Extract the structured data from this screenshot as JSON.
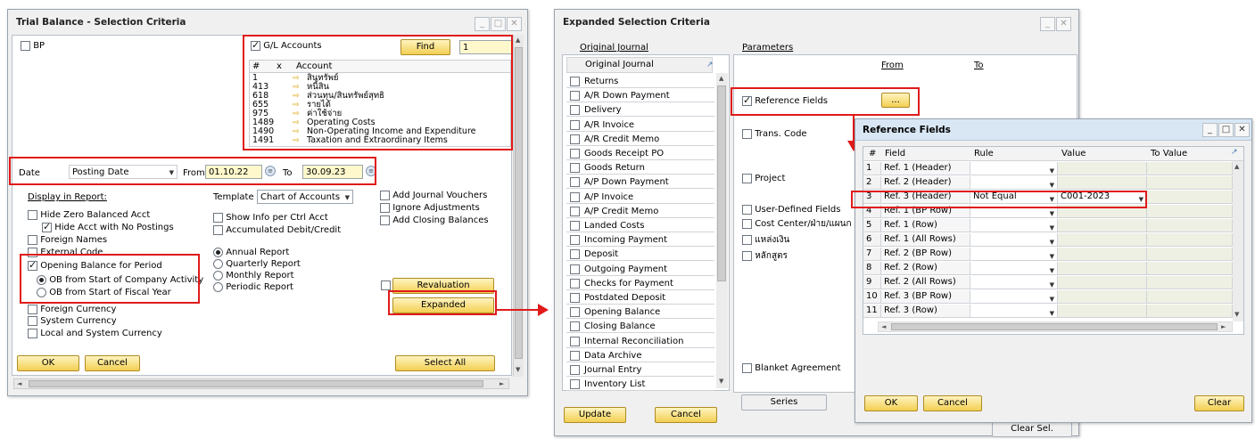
{
  "colors": {
    "accent": "#e01a1a",
    "button": "#f2cf52",
    "title_blue": "#d9e7f5"
  },
  "trial_balance": {
    "title": "Trial Balance - Selection Criteria",
    "bp_label": "BP",
    "gl_accounts_label": "G/L Accounts",
    "find_label": "Find",
    "find_value": "1",
    "accounts_headers": [
      "#",
      "x",
      "Account"
    ],
    "accounts": [
      {
        "num": "1",
        "name": "สินทรัพย์"
      },
      {
        "num": "413",
        "name": "หนี้สิน"
      },
      {
        "num": "618",
        "name": "ส่วนทุน/สินทรัพย์สุทธิ"
      },
      {
        "num": "655",
        "name": "รายได้"
      },
      {
        "num": "975",
        "name": "ค่าใช้จ่าย"
      },
      {
        "num": "1489",
        "name": "Operating Costs"
      },
      {
        "num": "1490",
        "name": "Non-Operating Income and Expenditure"
      },
      {
        "num": "1491",
        "name": "Taxation and Extraordinary Items"
      }
    ],
    "date_label": "Date",
    "date_type": "Posting Date",
    "from_label": "From",
    "from_date": "01.10.22",
    "to_label": "To",
    "to_date": "30.09.23",
    "display_in_report": "Display in Report:",
    "template_label": "Template",
    "template_value": "Chart of Accounts",
    "hide_zero": "Hide Zero Balanced Acct",
    "hide_no_postings": "Hide Acct with No Postings",
    "foreign_names": "Foreign Names",
    "external_code": "External Code",
    "opening_balance": "Opening Balance for Period",
    "ob_company": "OB from Start of Company Activity",
    "ob_fiscal": "OB from Start of Fiscal Year",
    "foreign_currency": "Foreign Currency",
    "system_currency": "System Currency",
    "local_system_currency": "Local and System Currency",
    "show_info": "Show Info per Ctrl Acct",
    "accumulated": "Accumulated Debit/Credit",
    "annual": "Annual Report",
    "quarterly": "Quarterly Report",
    "monthly": "Monthly Report",
    "periodic": "Periodic Report",
    "add_journal": "Add Journal Vouchers",
    "ignore_adj": "Ignore Adjustments",
    "add_closing": "Add Closing Balances",
    "revaluation": "Revaluation",
    "expanded": "Expanded",
    "ok": "OK",
    "cancel": "Cancel",
    "select_all": "Select All"
  },
  "expanded": {
    "title": "Expanded Selection Criteria",
    "original_journal_tab": "Original Journal",
    "parameters_tab": "Parameters",
    "list_header": "Original Journal",
    "journals": [
      "Returns",
      "A/R Down Payment",
      "Delivery",
      "A/R Invoice",
      "A/R Credit Memo",
      "Goods Receipt PO",
      "Goods Return",
      "A/P Down Payment",
      "A/P Invoice",
      "A/P Credit Memo",
      "Landed Costs",
      "Incoming Payment",
      "Deposit",
      "Outgoing Payment",
      "Checks for Payment",
      "Postdated Deposit",
      "Opening Balance",
      "Closing Balance",
      "Internal Reconciliation",
      "Data Archive",
      "Journal Entry",
      "Inventory List"
    ],
    "from_label": "From",
    "to_label": "To",
    "reference_fields": "Reference Fields",
    "ellipsis": "...",
    "trans_code": "Trans. Code",
    "project": "Project",
    "udf": "User-Defined Fields",
    "cost_center": "Cost Center/ฝ่าย/แผนก",
    "source_money": "แหล่งเงิน",
    "course": "หลักสูตร",
    "blanket": "Blanket Agreement",
    "series": "Series",
    "clear_sel": "Clear Sel.",
    "update": "Update",
    "cancel": "Cancel"
  },
  "reference_fields": {
    "title": "Reference Fields",
    "headers": [
      "#",
      "Field",
      "Rule",
      "Value",
      "To Value"
    ],
    "rows": [
      {
        "n": "1",
        "field": "Ref. 1 (Header)",
        "rule": "",
        "value": ""
      },
      {
        "n": "2",
        "field": "Ref. 2 (Header)",
        "rule": "",
        "value": ""
      },
      {
        "n": "3",
        "field": "Ref. 3 (Header)",
        "rule": "Not Equal",
        "value": "C001-2023"
      },
      {
        "n": "4",
        "field": "Ref. 1 (BP Row)",
        "rule": "",
        "value": ""
      },
      {
        "n": "5",
        "field": "Ref. 1 (Row)",
        "rule": "",
        "value": ""
      },
      {
        "n": "6",
        "field": "Ref. 1 (All Rows)",
        "rule": "",
        "value": ""
      },
      {
        "n": "7",
        "field": "Ref. 2 (BP Row)",
        "rule": "",
        "value": ""
      },
      {
        "n": "8",
        "field": "Ref. 2 (Row)",
        "rule": "",
        "value": ""
      },
      {
        "n": "9",
        "field": "Ref. 2 (All Rows)",
        "rule": "",
        "value": ""
      },
      {
        "n": "10",
        "field": "Ref. 3 (BP Row)",
        "rule": "",
        "value": ""
      },
      {
        "n": "11",
        "field": "Ref. 3 (Row)",
        "rule": "",
        "value": ""
      }
    ],
    "ok": "OK",
    "cancel": "Cancel",
    "clear": "Clear"
  }
}
